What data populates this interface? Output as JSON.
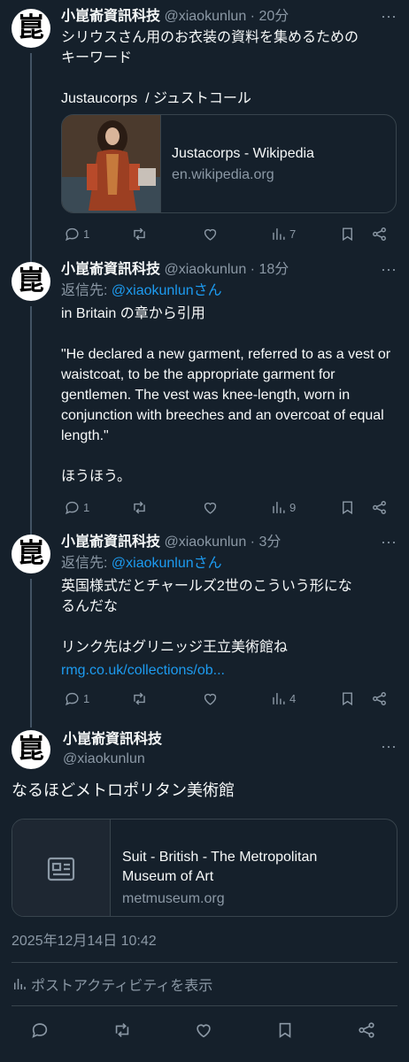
{
  "tweets": [
    {
      "name": "小崑嵛資訊科技",
      "handle": "@xiaokunlun",
      "time": "· 20分",
      "text": "シリウスさん用のお衣装の資料を集めるための\nキーワード\n\nJustaucorps  / ジュストコール",
      "card": {
        "title": "Justacorps - Wikipedia",
        "domain": "en.wikipedia.org"
      },
      "replies": "1",
      "views": "7"
    },
    {
      "name": "小崑嵛資訊科技",
      "handle": "@xiaokunlun",
      "time": "· 18分",
      "reply_prefix": "返信先: ",
      "reply_to": "@xiaokunlunさん",
      "text": "in Britain の章から引用\n\n\"He declared a new garment, referred to as a vest or waistcoat, to be the appropriate garment for gentlemen. The vest was knee-length, worn in conjunction with breeches and an overcoat of equal length.\"\n\nほうほう。",
      "replies": "1",
      "views": "9"
    },
    {
      "name": "小崑嵛資訊科技",
      "handle": "@xiaokunlun",
      "time": "· 3分",
      "reply_prefix": "返信先: ",
      "reply_to": "@xiaokunlunさん",
      "text": "英国様式だとチャールズ2世のこういう形にな\nるんだな\n\nリンク先はグリニッジ王立美術館ね",
      "link": "rmg.co.uk/collections/ob...",
      "replies": "1",
      "views": "4"
    }
  ],
  "main_tweet": {
    "name": "小崑嵛資訊科技",
    "handle": "@xiaokunlun",
    "text": "なるほどメトロポリタン美術館",
    "card": {
      "title": "Suit - British - The Metropolitan Museum of Art",
      "domain": "metmuseum.org"
    },
    "timestamp": "2025年12月14日 10:42",
    "activity": "ポストアクティビティを表示"
  },
  "avatar_glyph": "崑",
  "colors": {
    "background": "#15202b",
    "accent": "#1d9bf0",
    "muted": "#8b98a5",
    "border": "#38444d"
  },
  "icons": [
    "reply-icon",
    "retweet-icon",
    "like-icon",
    "views-icon",
    "bookmark-icon",
    "share-icon",
    "more-icon",
    "article-icon"
  ]
}
